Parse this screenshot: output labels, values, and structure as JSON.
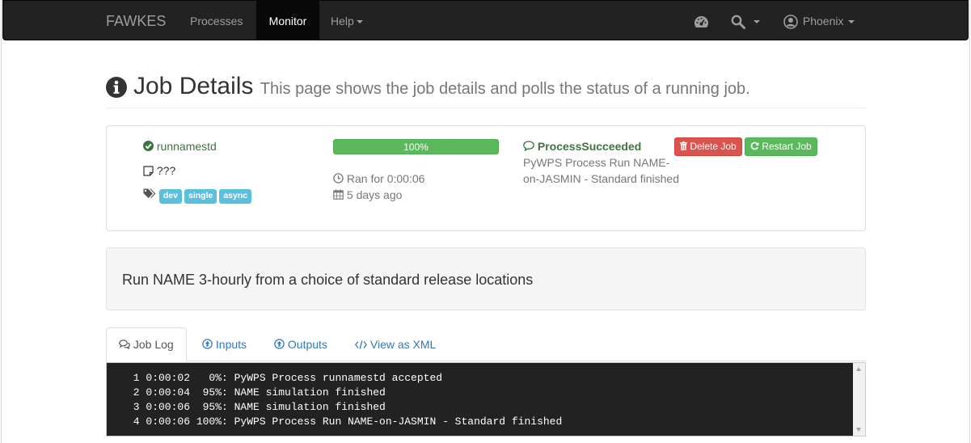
{
  "navbar": {
    "brand": "FAWKES",
    "items": [
      {
        "label": "Processes"
      },
      {
        "label": "Monitor"
      },
      {
        "label": "Help"
      }
    ],
    "user": "Phoenix"
  },
  "header": {
    "title": "Job Details",
    "subtitle": "This page shows the job details and polls the status of a running job."
  },
  "job": {
    "name": "runnamestd",
    "caption": "???",
    "tags": [
      "dev",
      "single",
      "async"
    ],
    "progress_percent": 100,
    "progress_label": "100%",
    "duration": "Ran for 0:00:06",
    "created": "5 days ago",
    "status": "ProcessSucceeded",
    "status_message_line1": "PyWPS Process Run NAME-",
    "status_message_line2": "on-JASMIN - Standard finished",
    "delete_label": "Delete Job",
    "restart_label": "Restart Job"
  },
  "abstract": "Run NAME 3-hourly from a choice of standard release locations",
  "tabs": [
    {
      "label": "Job Log"
    },
    {
      "label": "Inputs"
    },
    {
      "label": "Outputs"
    },
    {
      "label": "View as XML"
    }
  ],
  "log_lines": [
    " 1 0:00:02   0%: PyWPS Process runnamestd accepted",
    " 2 0:00:04  95%: NAME simulation finished",
    " 3 0:00:06  95%: NAME simulation finished",
    " 4 0:00:06 100%: PyWPS Process Run NAME-on-JASMIN - Standard finished"
  ],
  "colors": {
    "navbar_bg": "#222222",
    "success": "#5cb85c",
    "danger": "#d9534f",
    "info_label": "#5bc0de",
    "link": "#337ab7",
    "status_green": "#3c763d"
  }
}
